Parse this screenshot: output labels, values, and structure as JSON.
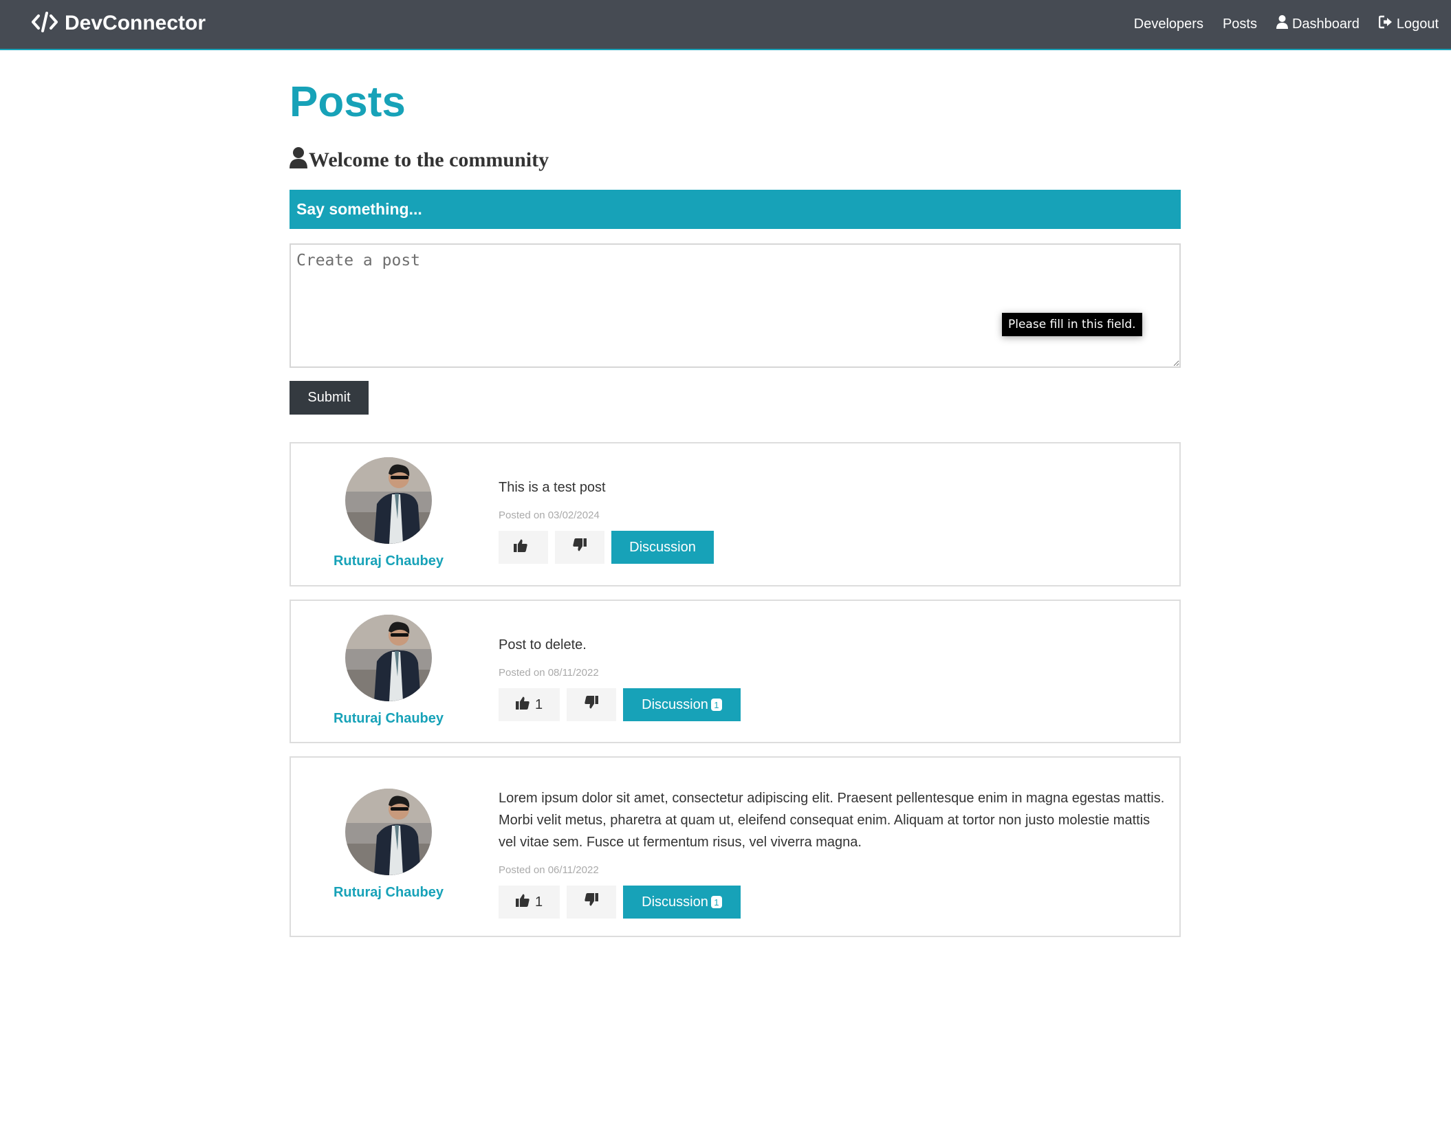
{
  "navbar": {
    "brand": "DevConnector",
    "links": [
      {
        "label": "Developers",
        "icon": "none"
      },
      {
        "label": "Posts",
        "icon": "none"
      },
      {
        "label": "Dashboard",
        "icon": "user-icon"
      },
      {
        "label": "Logout",
        "icon": "sign-out-icon"
      }
    ]
  },
  "page": {
    "title": "Posts",
    "lead": "Welcome to the community"
  },
  "post_form": {
    "header": "Say something...",
    "placeholder": "Create a post",
    "value": "",
    "validation_tooltip": "Please fill in this field.",
    "submit_label": "Submit"
  },
  "posts": [
    {
      "author": "Ruturaj Chaubey",
      "text": "This is a test post",
      "date": "Posted on 03/02/2024",
      "likes": "",
      "discussion_label": "Discussion",
      "comments": ""
    },
    {
      "author": "Ruturaj Chaubey",
      "text": "Post to delete.",
      "date": "Posted on 08/11/2022",
      "likes": "1",
      "discussion_label": "Discussion",
      "comments": "1"
    },
    {
      "author": "Ruturaj Chaubey",
      "text": "Lorem ipsum dolor sit amet, consectetur adipiscing elit. Praesent pellentesque enim in magna egestas mattis. Morbi velit metus, pharetra at quam ut, eleifend consequat enim. Aliquam at tortor non justo molestie mattis vel vitae sem. Fusce ut fermentum risus, vel viverra magna.",
      "date": "Posted on 06/11/2022",
      "likes": "1",
      "discussion_label": "Discussion",
      "comments": "1"
    }
  ],
  "colors": {
    "primary": "#17a2b8",
    "navbar": "#464b53",
    "dark": "#343a40",
    "light": "#f4f4f4"
  }
}
